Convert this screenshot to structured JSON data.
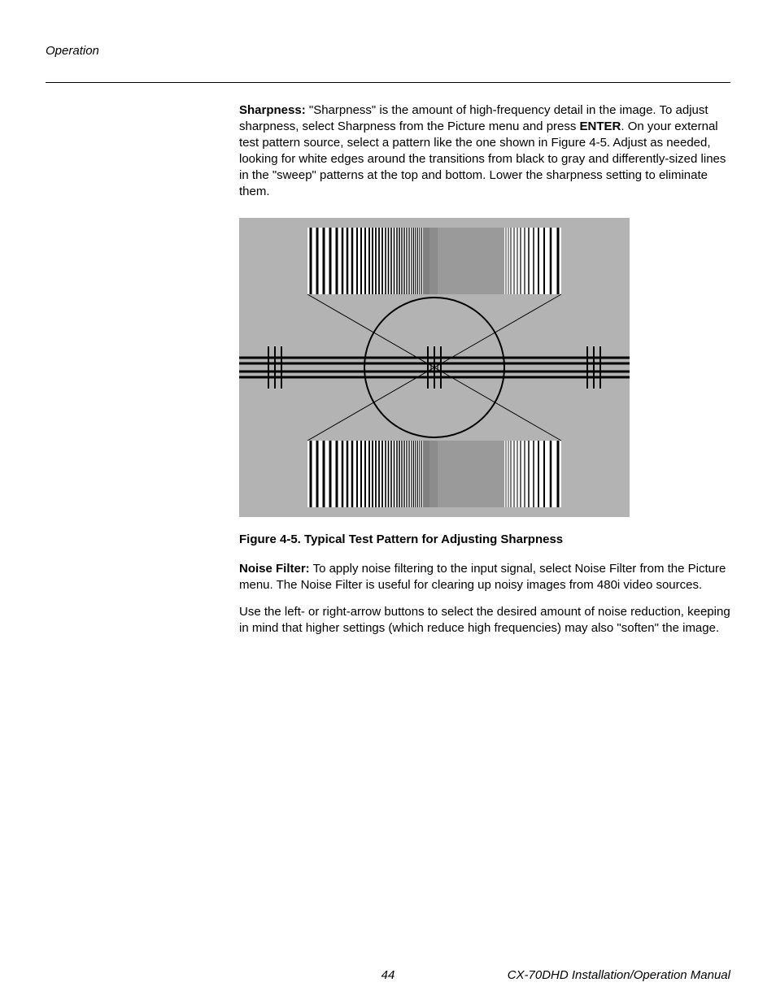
{
  "header": {
    "section": "Operation"
  },
  "body": {
    "sharpness": {
      "label": "Sharpness:",
      "text_pre_enter": " \"Sharpness\" is the amount of high-frequency detail in the image. To adjust sharpness, select Sharpness from the Picture menu and press ",
      "enter": "ENTER",
      "text_post_enter": ". On your external test pattern source, select a pattern like the one shown in Figure 4-5. Adjust as needed, looking for white edges around the transitions from black to gray and differently-sized lines in the \"sweep\" patterns at the top and bottom. Lower the sharpness setting to eliminate them."
    },
    "figure_caption": "Figure 4-5. Typical Test Pattern for Adjusting Sharpness",
    "noise_filter": {
      "label": "Noise Filter:",
      "text": " To apply noise filtering to the input signal, select Noise Filter from the Picture menu. The Noise Filter is useful for clearing up noisy images from 480i video sources."
    },
    "noise_filter_2": "Use the left- or right-arrow buttons to select the desired amount of noise reduction, keeping in mind that higher settings (which reduce high frequencies) may also \"soften\" the image."
  },
  "footer": {
    "page_number": "44",
    "manual_title": "CX-70DHD Installation/Operation Manual"
  }
}
